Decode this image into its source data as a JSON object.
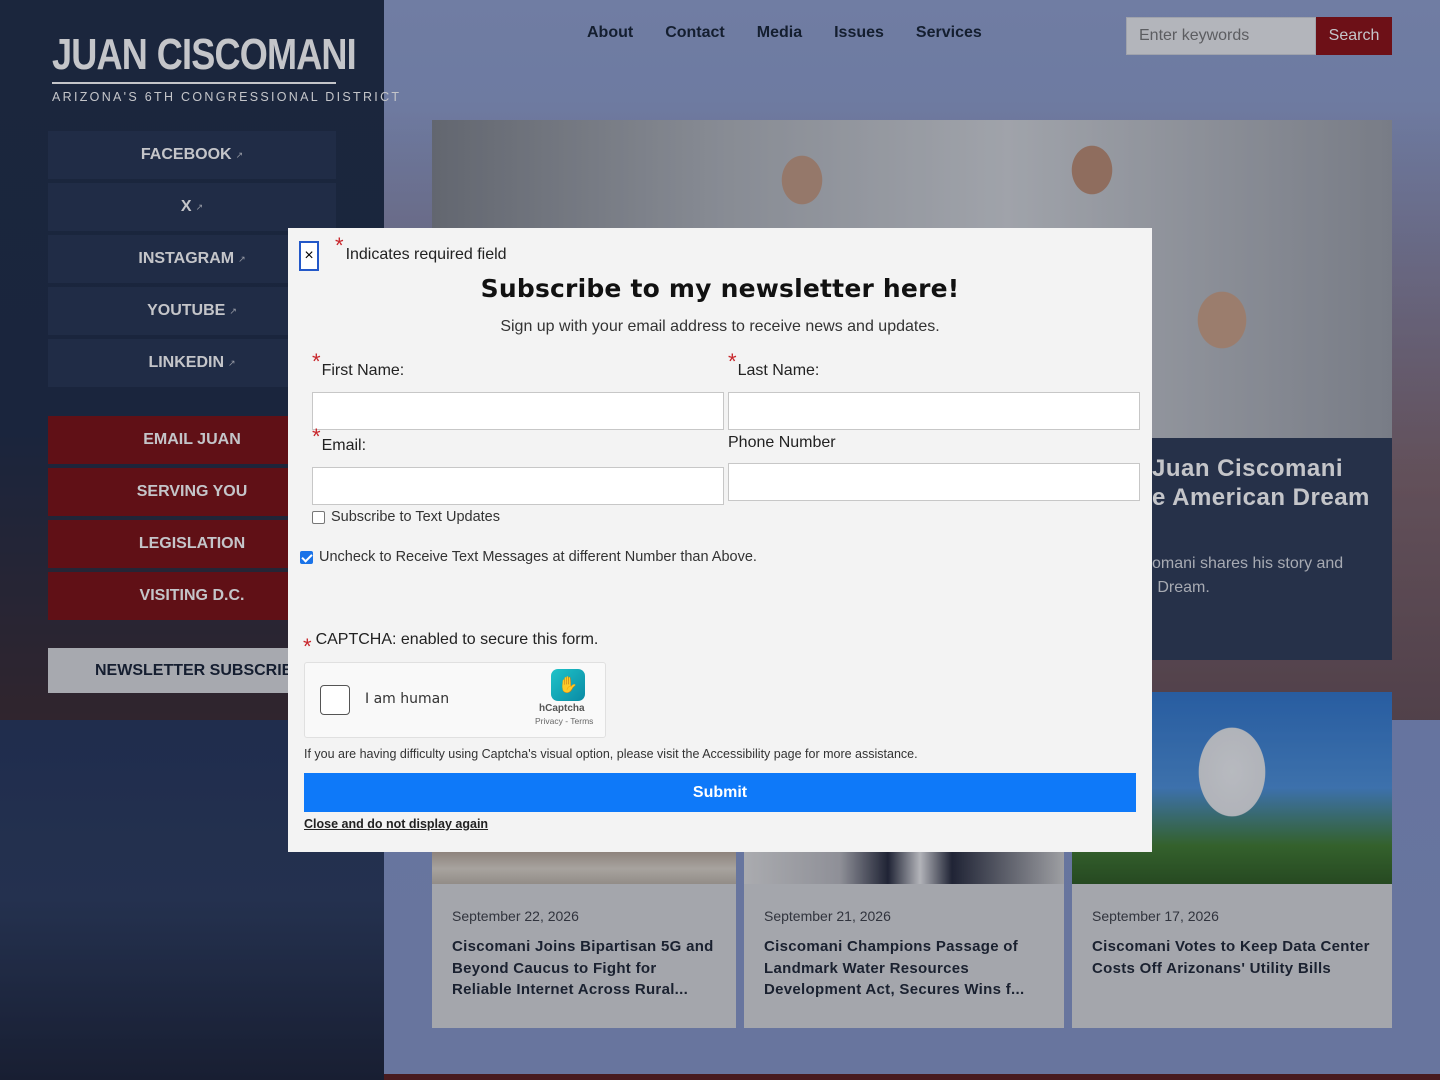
{
  "logo": {
    "name": "JUAN CISCOMANI",
    "first": "JUAN",
    "last": "CISCOMANI",
    "subtitle": "ARIZONA'S 6TH CONGRESSIONAL DISTRICT"
  },
  "sidebar": {
    "social": [
      {
        "label": "FACEBOOK"
      },
      {
        "label": "X"
      },
      {
        "label": "INSTAGRAM"
      },
      {
        "label": "YOUTUBE"
      },
      {
        "label": "LINKEDIN"
      }
    ],
    "actions": [
      {
        "label": "EMAIL JUAN"
      },
      {
        "label": "SERVING YOU"
      },
      {
        "label": "LEGISLATION"
      },
      {
        "label": "VISITING D.C."
      }
    ],
    "newsletter_label": "NEWSLETTER SUBSCRIBE"
  },
  "nav": {
    "items": [
      "About",
      "Contact",
      "Media",
      "Issues",
      "Services"
    ]
  },
  "search": {
    "placeholder": "Enter keywords",
    "button": "Search"
  },
  "hero": {
    "title_line1": "Juan Ciscomani",
    "title_line2": "e American Dream",
    "desc_line1": "comani shares his story and",
    "desc_line2": "n Dream."
  },
  "cards": [
    {
      "date": "September 22, 2026",
      "title": "Ciscomani Joins Bipartisan 5G and Beyond Caucus to Fight for Reliable Internet Across Rural..."
    },
    {
      "date": "September 21, 2026",
      "title": "Ciscomani Champions Passage of Landmark Water Resources Development Act, Secures Wins f..."
    },
    {
      "date": "September 17, 2026",
      "title": "Ciscomani Votes to Keep Data Center Costs Off Arizonans' Utility Bills"
    }
  ],
  "modal": {
    "close_glyph": "×",
    "required_star": "*",
    "required_note": "Indicates required field",
    "title": "Subscribe to my newsletter here!",
    "subtitle": "Sign up with your email address to receive news and updates.",
    "first_name_label": "First Name:",
    "last_name_label": "Last Name:",
    "email_label": "Email:",
    "phone_label": "Phone Number",
    "text_updates_label": "Subscribe to Text Updates",
    "text_updates_checked": false,
    "uncheck_label": "Uncheck to Receive Text Messages at different Number than Above.",
    "uncheck_checked": true,
    "captcha_label": "CAPTCHA: enabled to secure this form.",
    "captcha_text": "I am human",
    "hcaptcha_name": "hCaptcha",
    "hcaptcha_links": "Privacy - Terms",
    "captcha_help": "If you are having difficulty using Captcha's visual option, please visit the Accessibility page for more assistance.",
    "submit": "Submit",
    "close_link": "Close and do not display again"
  },
  "colors": {
    "accent_red": "#7a0e10",
    "submit_blue": "#0e79f9",
    "navy": "#1e2b45"
  }
}
